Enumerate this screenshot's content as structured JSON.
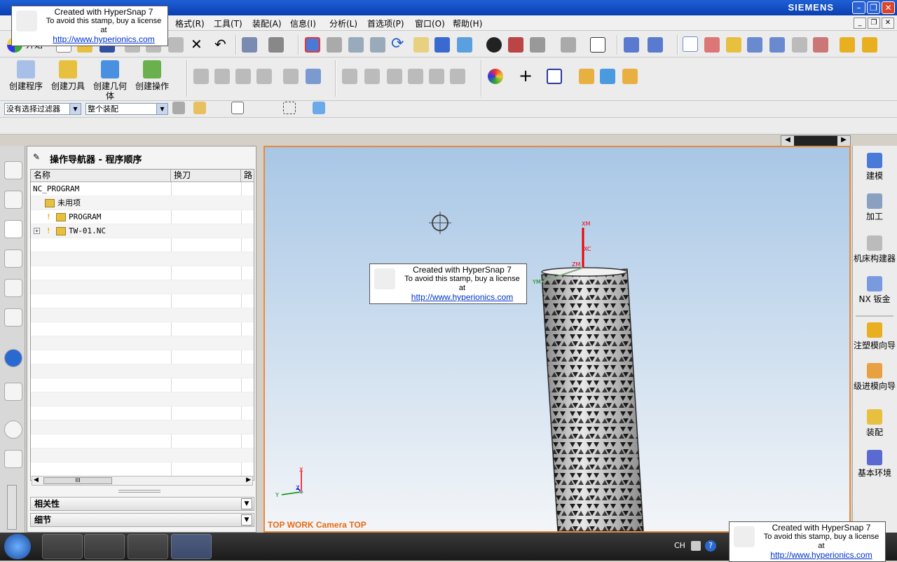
{
  "titlebar": {
    "brand": "SIEMENS"
  },
  "menu": {
    "items": [
      "格式(R)",
      "工具(T)",
      "装配(A)",
      "信息(I)",
      "分析(L)",
      "首选项(P)",
      "窗口(O)",
      "帮助(H)"
    ]
  },
  "toolbar": {
    "start_label": "开始",
    "create_program": "创建程序",
    "create_tool": "创建刀具",
    "create_geometry": "创建几何体",
    "create_operation": "创建操作"
  },
  "selection_bar": {
    "filter": "没有选择过滤器",
    "scope": "整个装配"
  },
  "navigator": {
    "title": "操作导航器 - 程序顺序",
    "columns": [
      "名称",
      "换刀",
      "路"
    ],
    "rows": [
      {
        "name": "NC_PROGRAM"
      },
      {
        "name": "未用项"
      },
      {
        "name": "PROGRAM"
      },
      {
        "name": "TW-01.NC"
      }
    ],
    "scroll_grip": "III",
    "panels": [
      "相关性",
      "细节"
    ]
  },
  "viewport": {
    "label": "TOP WORK Camera TOP",
    "axes": {
      "x": "XM",
      "xc": "XC",
      "zm": "ZM",
      "ym": "YM",
      "tx": "X",
      "ty": "Y",
      "tz": "Z"
    }
  },
  "right_bar": {
    "items": [
      "建模",
      "加工",
      "机床构建器",
      "NX 钣金",
      "注塑模向导",
      "级进模向导",
      "装配",
      "基本环境"
    ]
  },
  "stamp": {
    "line1": "Created with HyperSnap 7",
    "line2": "To avoid this stamp, buy a license at",
    "line3": "http://www.hyperionics.com"
  },
  "taskbar": {
    "lang": "CH"
  }
}
